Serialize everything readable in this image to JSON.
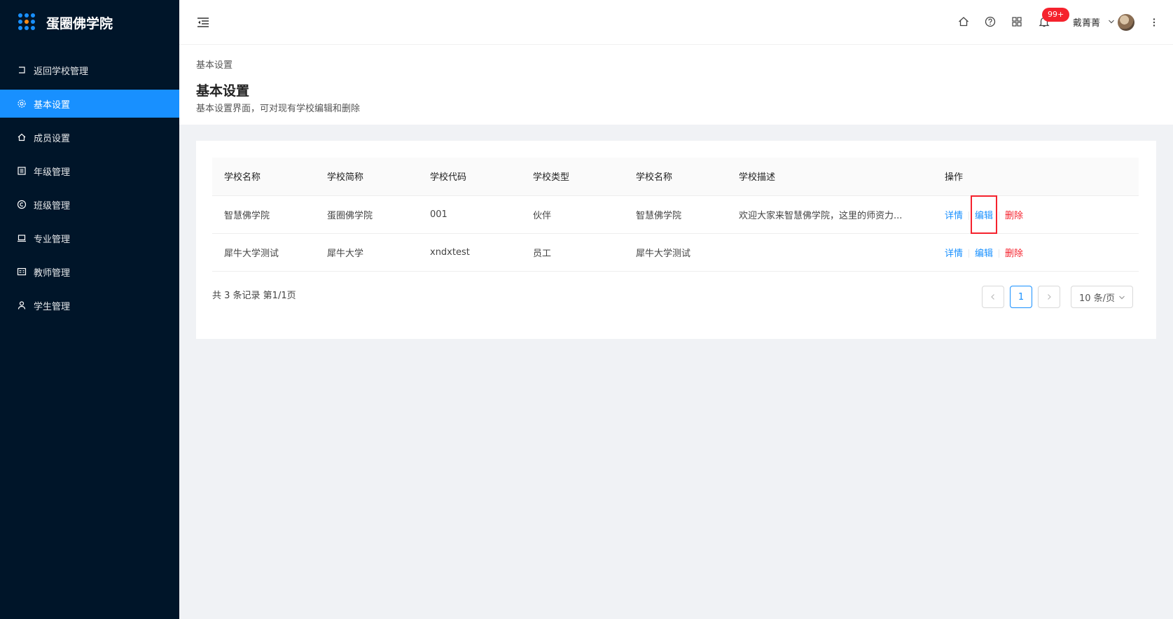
{
  "app": {
    "title": "蛋圈佛学院"
  },
  "sidebar": {
    "items": [
      {
        "label": "返回学校管理",
        "icon": "back-icon",
        "active": false
      },
      {
        "label": "基本设置",
        "icon": "gear-icon",
        "active": true
      },
      {
        "label": "成员设置",
        "icon": "home-icon",
        "active": false
      },
      {
        "label": "年级管理",
        "icon": "list-icon",
        "active": false
      },
      {
        "label": "班级管理",
        "icon": "copyright-icon",
        "active": false
      },
      {
        "label": "专业管理",
        "icon": "laptop-icon",
        "active": false
      },
      {
        "label": "教师管理",
        "icon": "id-card-icon",
        "active": false
      },
      {
        "label": "学生管理",
        "icon": "user-icon",
        "active": false
      }
    ]
  },
  "header": {
    "notification_badge": "99+",
    "username": "戴菁菁"
  },
  "page": {
    "breadcrumb": "基本设置",
    "title": "基本设置",
    "description": "基本设置界面，可对现有学校编辑和删除"
  },
  "table": {
    "columns": [
      "学校名称",
      "学校简称",
      "学校代码",
      "学校类型",
      "学校名称",
      "学校描述",
      "操作"
    ],
    "rows": [
      {
        "name": "智慧佛学院",
        "short": "蛋圈佛学院",
        "code": "001",
        "type": "伙伴",
        "name2": "智慧佛学院",
        "desc": "欢迎大家来智慧佛学院，这里的师资力..."
      },
      {
        "name": "犀牛大学测试",
        "short": "犀牛大学",
        "code": "xndxtest",
        "type": "员工",
        "name2": "犀牛大学测试",
        "desc": ""
      }
    ],
    "actions": {
      "detail": "详情",
      "edit": "编辑",
      "delete": "删除"
    }
  },
  "pagination": {
    "total_text": "共 3 条记录 第1/1页",
    "current_page": "1",
    "page_size": "10 条/页"
  },
  "colors": {
    "sidebar_bg": "#001529",
    "accent": "#1890ff",
    "danger": "#f5222d"
  }
}
